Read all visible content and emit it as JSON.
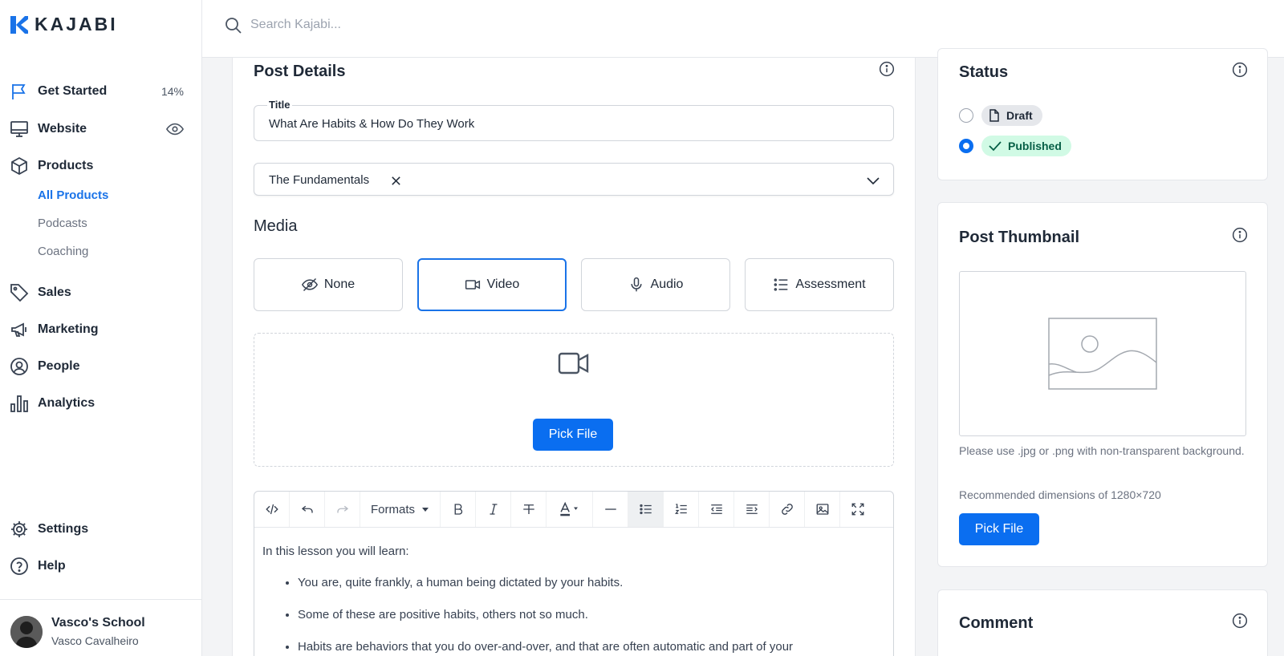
{
  "brand": {
    "name": "KAJABI",
    "accent": "#1a73e8",
    "button_blue": "#0a6ef0"
  },
  "search": {
    "placeholder": "Search Kajabi..."
  },
  "sidebar": {
    "items": [
      {
        "label": "Get Started",
        "icon": "flag-icon",
        "meta": "14%"
      },
      {
        "label": "Website",
        "icon": "monitor-icon",
        "meta_icon": "eye-icon"
      },
      {
        "label": "Products",
        "icon": "box-icon"
      },
      {
        "label": "Sales",
        "icon": "tag-icon"
      },
      {
        "label": "Marketing",
        "icon": "megaphone-icon"
      },
      {
        "label": "People",
        "icon": "user-circle-icon"
      },
      {
        "label": "Analytics",
        "icon": "bar-chart-icon"
      }
    ],
    "sub_items": [
      {
        "label": "All Products",
        "active": true
      },
      {
        "label": "Podcasts",
        "active": false
      },
      {
        "label": "Coaching",
        "active": false
      }
    ],
    "bottom_items": [
      {
        "label": "Settings",
        "icon": "gear-icon"
      },
      {
        "label": "Help",
        "icon": "help-circle-icon"
      }
    ],
    "footer": {
      "school": "Vasco's School",
      "user": "Vasco Cavalheiro"
    }
  },
  "post_details": {
    "title": "Post Details",
    "title_field_label": "Title",
    "title_value": "What Are Habits & How Do They Work",
    "category_value": "The Fundamentals"
  },
  "media": {
    "title": "Media",
    "options": [
      {
        "label": "None",
        "icon": "eye-off-icon",
        "selected": false
      },
      {
        "label": "Video",
        "icon": "video-icon",
        "selected": true
      },
      {
        "label": "Audio",
        "icon": "microphone-icon",
        "selected": false
      },
      {
        "label": "Assessment",
        "icon": "list-icon",
        "selected": false
      }
    ],
    "pick_file_label": "Pick File"
  },
  "editor": {
    "formats_label": "Formats",
    "intro": "In this lesson you will learn:",
    "bullets": [
      "You are, quite frankly, a human being dictated by your habits.",
      "Some of these are positive habits, others not so much.",
      "Habits are behaviors that you do over-and-over, and that are often automatic and part of your"
    ]
  },
  "status": {
    "title": "Status",
    "options": [
      {
        "label": "Draft",
        "icon": "file-icon",
        "checked": false
      },
      {
        "label": "Published",
        "icon": "check-icon",
        "checked": true
      }
    ]
  },
  "thumbnail": {
    "title": "Post Thumbnail",
    "help_1": "Please use .jpg or .png with non-transparent background.",
    "help_2": "Recommended dimensions of 1280×720",
    "pick_file_label": "Pick File"
  },
  "comment": {
    "title": "Comment"
  }
}
